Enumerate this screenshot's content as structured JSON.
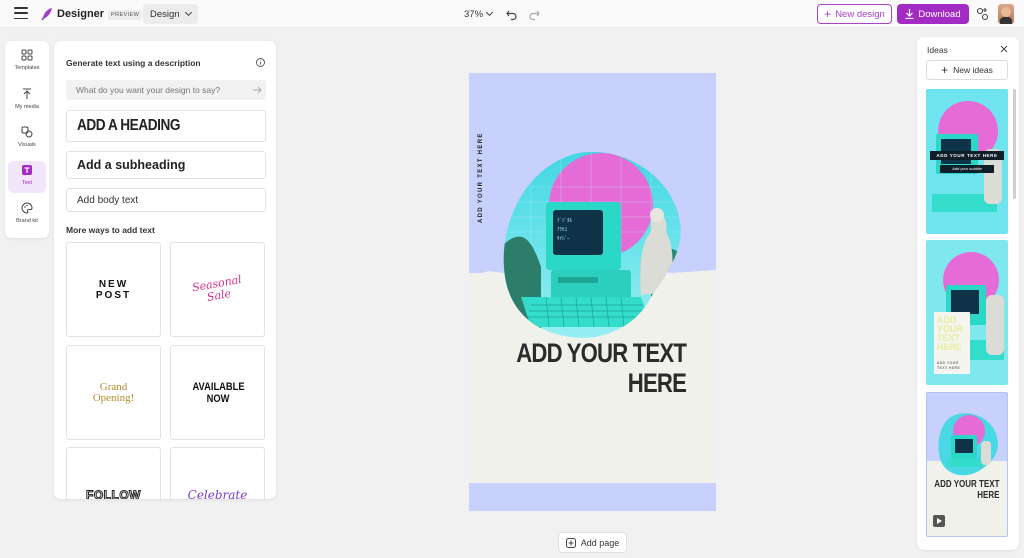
{
  "app": {
    "name": "Designer",
    "badge": "PREVIEW",
    "mode": "Design",
    "zoom": "37%",
    "new_design_label": "New design",
    "download_label": "Download",
    "accent_color": "#a22bc4"
  },
  "rail": {
    "items": [
      {
        "label": "Templates",
        "icon": "templates-icon"
      },
      {
        "label": "My media",
        "icon": "upload-icon"
      },
      {
        "label": "Visuals",
        "icon": "shapes-icon"
      },
      {
        "label": "Text",
        "icon": "text-icon",
        "active": true
      },
      {
        "label": "Brand kit",
        "icon": "palette-icon"
      }
    ]
  },
  "text_panel": {
    "title": "Generate text using a description",
    "prompt_placeholder": "What do you want your design to say?",
    "heading_label": "ADD A HEADING",
    "subheading_label": "Add a subheading",
    "body_label": "Add body text",
    "more_ways": "More ways to add text",
    "tiles": [
      {
        "text": "NEW POST"
      },
      {
        "text": "Seasonal Sale"
      },
      {
        "text": "Grand Opening!"
      },
      {
        "text": "AVAILABLE NOW"
      },
      {
        "text": "FOLLOW"
      },
      {
        "text": "Celebrate"
      }
    ]
  },
  "canvas": {
    "vertical_text": "ADD YOUR TEXT HERE",
    "main_text_line1": "ADD YOUR TEXT",
    "main_text_line2": "HERE",
    "background_color": "#c7d1fb"
  },
  "add_page_label": "Add page",
  "ideas": {
    "title": "Ideas",
    "new_ideas_label": "New ideas",
    "idea1_banner": "ADD YOUR TEXT HERE",
    "idea1_sub": "Add your subtitle",
    "idea2_text": "ADD YOUR TEXT HERE",
    "idea2_sub": "ADD YOUR TEXT HERE",
    "idea3_text_line1": "ADD YOUR TEXT",
    "idea3_text_line2": "HERE"
  }
}
